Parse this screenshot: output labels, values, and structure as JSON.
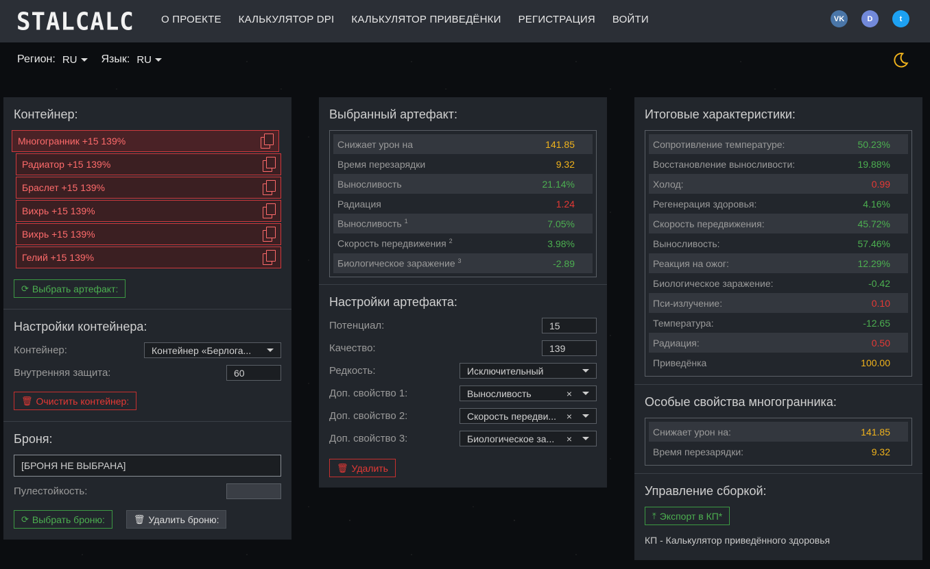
{
  "logo": "STALCALC",
  "nav": [
    "О ПРОЕКТЕ",
    "КАЛЬКУЛЯТОР DPI",
    "КАЛЬКУЛЯТОР ПРИВЕДЁНКИ",
    "РЕГИСТРАЦИЯ",
    "ВОЙТИ"
  ],
  "social": {
    "vk": "VK",
    "discord": "D",
    "twitter": "t"
  },
  "subbar": {
    "region_label": "Регион:",
    "region": "RU",
    "lang_label": "Язык:",
    "lang": "RU"
  },
  "left": {
    "container_title": "Контейнер:",
    "slots": [
      "Многогранник +15 139%",
      "Радиатор +15 139%",
      "Браслет +15 139%",
      "Вихрь +15 139%",
      "Вихрь +15 139%",
      "Гелий +15 139%"
    ],
    "choose_artifact": "Выбрать артефакт:",
    "settings_title": "Настройки контейнера:",
    "container_label": "Контейнер:",
    "container_value": "Контейнер «Берлога...",
    "inner_protection_label": "Внутренняя защита:",
    "inner_protection_value": "60",
    "clear_container": "Очистить контейнер:",
    "armor_title": "Броня:",
    "armor_value": "[БРОНЯ НЕ ВЫБРАНА]",
    "bullet_label": "Пулестойкость:",
    "choose_armor": "Выбрать броню:",
    "delete_armor": "Удалить броню:"
  },
  "middle": {
    "selected_title": "Выбранный артефакт:",
    "stats": [
      {
        "label": "Снижает урон на",
        "sup": "",
        "value": "141.85",
        "color": "y"
      },
      {
        "label": "Время перезарядки",
        "sup": "",
        "value": "9.32",
        "color": "y"
      },
      {
        "label": "Выносливость",
        "sup": "",
        "value": "21.14%",
        "color": "g"
      },
      {
        "label": "Радиация",
        "sup": "",
        "value": "1.24",
        "color": "r"
      },
      {
        "label": "Выносливость",
        "sup": "1",
        "value": "7.05%",
        "color": "g"
      },
      {
        "label": "Скорость передвижения",
        "sup": "2",
        "value": "3.98%",
        "color": "g"
      },
      {
        "label": "Биологическое заражение",
        "sup": "3",
        "value": "-2.89",
        "color": "g"
      }
    ],
    "settings_title": "Настройки артефакта:",
    "potential_label": "Потенциал:",
    "potential_value": "15",
    "quality_label": "Качество:",
    "quality_value": "139",
    "rarity_label": "Редкость:",
    "rarity_value": "Исключительный",
    "prop1_label": "Доп. свойство 1:",
    "prop1_value": "Выносливость",
    "prop2_label": "Доп. свойство 2:",
    "prop2_value": "Скорость передви...",
    "prop3_label": "Доп. свойство 3:",
    "prop3_value": "Биологическое за...",
    "clear_symbol": "×",
    "delete": "Удалить"
  },
  "right": {
    "totals_title": "Итоговые характеристики:",
    "totals": [
      {
        "label": "Сопротивление температуре:",
        "value": "50.23%",
        "color": "g"
      },
      {
        "label": "Восстановление выносливости:",
        "value": "19.88%",
        "color": "g"
      },
      {
        "label": "Холод:",
        "value": "0.99",
        "color": "r"
      },
      {
        "label": "Регенерация здоровья:",
        "value": "4.16%",
        "color": "g"
      },
      {
        "label": "Скорость передвижения:",
        "value": "45.72%",
        "color": "g"
      },
      {
        "label": "Выносливость:",
        "value": "57.46%",
        "color": "g"
      },
      {
        "label": "Реакция на ожог:",
        "value": "12.29%",
        "color": "g"
      },
      {
        "label": "Биологическое заражение:",
        "value": "-0.42",
        "color": "g"
      },
      {
        "label": "Пси-излучение:",
        "value": "0.10",
        "color": "r"
      },
      {
        "label": "Температура:",
        "value": "-12.65",
        "color": "g"
      },
      {
        "label": "Радиация:",
        "value": "0.50",
        "color": "r"
      },
      {
        "label": "Приведёнка",
        "value": "100.00",
        "color": "y"
      }
    ],
    "special_title": "Особые свойства многогранника:",
    "special": [
      {
        "label": "Снижает урон на:",
        "value": "141.85",
        "color": "y"
      },
      {
        "label": "Время перезарядки:",
        "value": "9.32",
        "color": "y"
      }
    ],
    "manage_title": "Управление сборкой:",
    "export": "Экспорт в КП*",
    "footnote": "КП - Калькулятор приведённого здоровья"
  }
}
